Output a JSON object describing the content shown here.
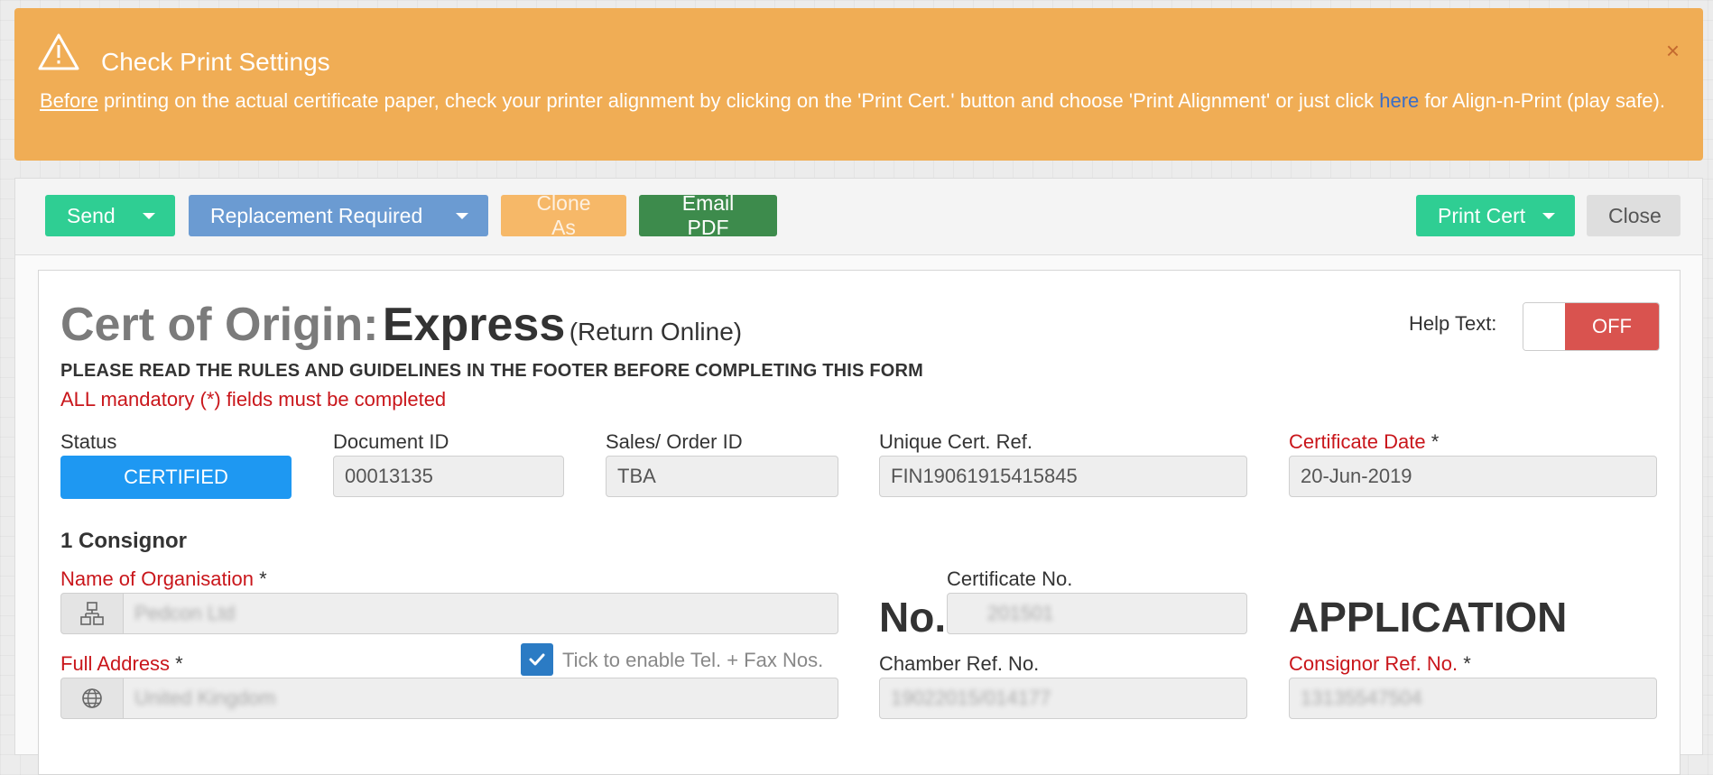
{
  "alert": {
    "title": "Check Print Settings",
    "close_glyph": "×",
    "text_underlined": "Before",
    "text_main": " printing on the actual certificate paper, check your printer alignment by clicking on the 'Print Cert.' button and choose 'Print Alignment' or just click ",
    "link": "here",
    "text_end": " for Align-n-Print (play safe)."
  },
  "toolbar": {
    "send": "Send",
    "replacement": "Replacement Required",
    "clone": "Clone As",
    "email": "Email PDF",
    "print": "Print Cert",
    "close": "Close"
  },
  "form": {
    "title_prefix": "Cert of Origin:",
    "title_main": "Express",
    "title_sub": "(Return Online)",
    "help_label": "Help Text:",
    "help_toggle": "OFF",
    "rules": "PLEASE READ THE RULES AND GUIDELINES IN THE FOOTER BEFORE COMPLETING THIS FORM",
    "mandatory": "ALL mandatory (*) fields must be completed",
    "status_label": "Status",
    "status_value": "CERTIFIED",
    "document_id_label": "Document ID",
    "document_id": "00013135",
    "sales_order_label": "Sales/ Order ID",
    "sales_order": "TBA",
    "unique_ref_label": "Unique Cert. Ref.",
    "unique_ref": "FIN19061915415845",
    "cert_date_label": "Certificate Date",
    "cert_date": "20-Jun-2019",
    "required_star": " *",
    "section_consignor": "1 Consignor",
    "org_name_label": "Name of Organisation",
    "org_name": "Pedcon Ltd",
    "cert_no_label": "Certificate No.",
    "no_text": "No.",
    "cert_no": "201501",
    "application_text": "APPLICATION",
    "address_label": "Full Address",
    "address": "United Kingdom",
    "tick_label": "Tick to enable Tel. + Fax Nos.",
    "chamber_ref_label": "Chamber Ref. No.",
    "chamber_ref": "19022015/014177",
    "consignor_ref_label": "Consignor Ref. No.",
    "consignor_ref": "13135547504"
  },
  "icons": {
    "warning": "warning-icon",
    "org": "org-chart-icon",
    "globe": "globe-icon",
    "check": "check-icon"
  },
  "colors": {
    "alert_bg": "#f0ad55",
    "send": "#2fce93",
    "replacement": "#6b9bd2",
    "clone": "#f6b868",
    "email": "#3d8b4c",
    "status": "#1e98f2",
    "toggle_off": "#d9534f",
    "required": "#c9161b"
  }
}
